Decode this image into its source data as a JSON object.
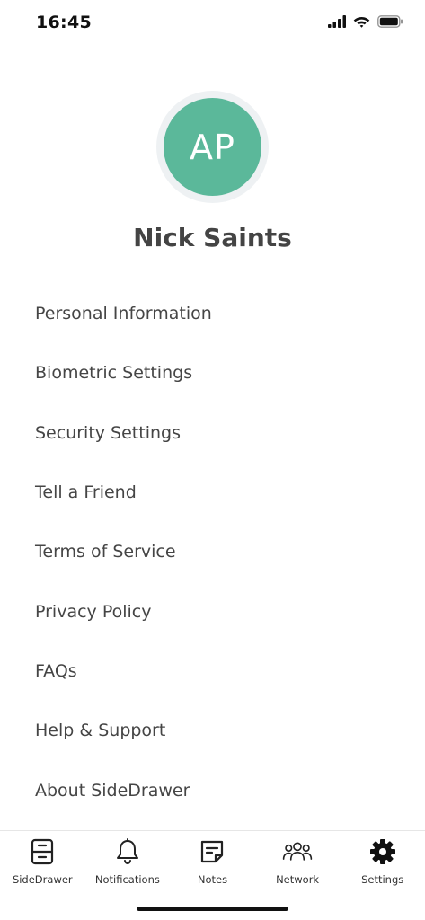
{
  "status_bar": {
    "time": "16:45",
    "icons": [
      "cellular-signal-icon",
      "wifi-icon",
      "battery-icon"
    ]
  },
  "profile": {
    "initials": "AP",
    "name": "Nick Saints",
    "avatar_color": "#5bb89a"
  },
  "menu": {
    "items": [
      {
        "label": "Personal Information"
      },
      {
        "label": "Biometric Settings"
      },
      {
        "label": "Security Settings"
      },
      {
        "label": "Tell a Friend"
      },
      {
        "label": "Terms of Service"
      },
      {
        "label": "Privacy Policy"
      },
      {
        "label": "FAQs"
      },
      {
        "label": "Help & Support"
      },
      {
        "label": "About SideDrawer"
      }
    ]
  },
  "tab_bar": {
    "active": "Settings",
    "tabs": [
      {
        "label": "SideDrawer",
        "icon": "drawer-icon"
      },
      {
        "label": "Notifications",
        "icon": "bell-icon"
      },
      {
        "label": "Notes",
        "icon": "note-icon"
      },
      {
        "label": "Network",
        "icon": "people-icon"
      },
      {
        "label": "Settings",
        "icon": "gear-icon"
      }
    ]
  }
}
